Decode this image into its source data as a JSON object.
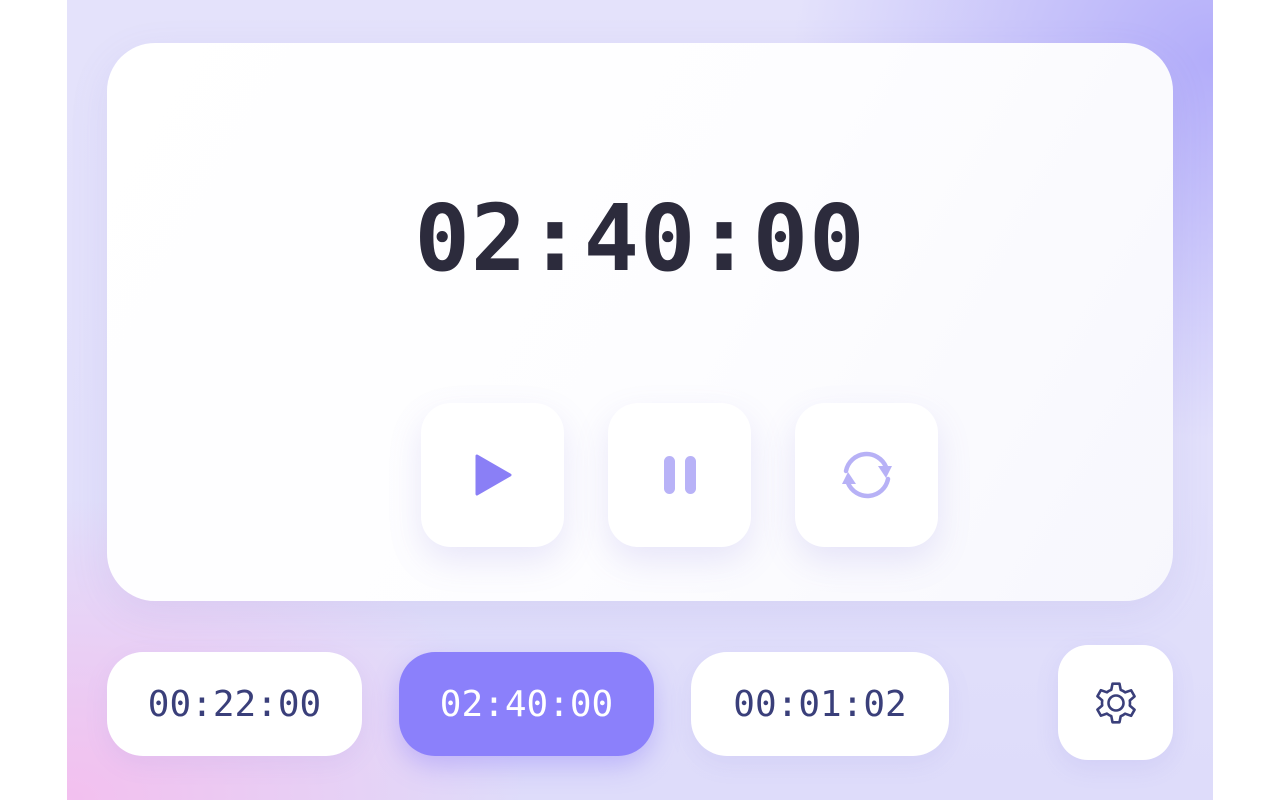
{
  "timer": {
    "display": "02:40:00"
  },
  "controls": {
    "play_icon": "play-icon",
    "pause_icon": "pause-icon",
    "reset_icon": "refresh-icon"
  },
  "presets": [
    {
      "label": "00:22:00",
      "selected": false
    },
    {
      "label": "02:40:00",
      "selected": true
    },
    {
      "label": "00:01:02",
      "selected": false
    }
  ],
  "settings": {
    "icon": "gear-icon"
  },
  "colors": {
    "accent": "#8b80fb",
    "play_icon": "#8a7ff6",
    "pause_icon": "#b8b2f7",
    "reset_icon": "#b7b1f6",
    "timer_text": "#2c2b3c",
    "preset_text": "#3a3f7a"
  }
}
